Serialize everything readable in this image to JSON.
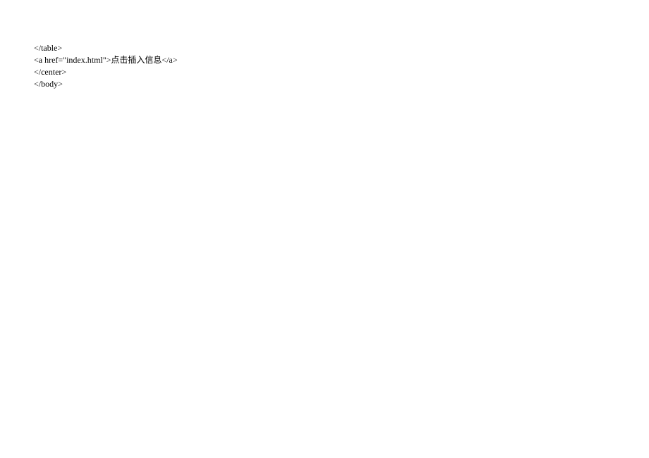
{
  "code": {
    "line1": "</table>",
    "line2": "<a href=\"index.html\">点击插入信息</a>",
    "line3": "</center>",
    "line4": "</body>"
  }
}
